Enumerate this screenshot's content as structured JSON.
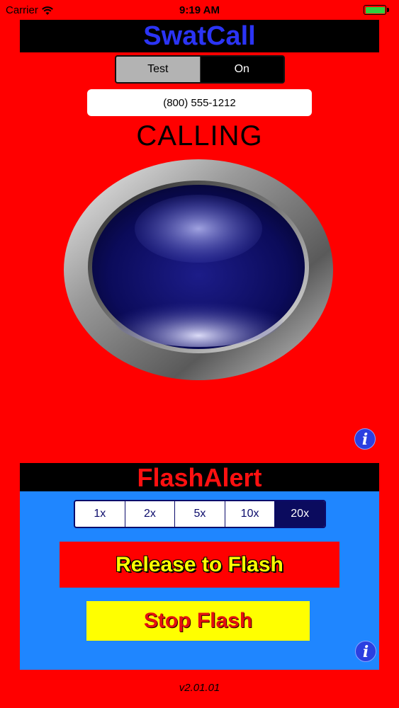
{
  "status_bar": {
    "carrier": "Carrier",
    "time": "9:19 AM",
    "battery_level": 1.0
  },
  "swatcall": {
    "title": "SwatCall",
    "title_color": "#2b34f5",
    "mode_options": [
      "Test",
      "On"
    ],
    "mode_selected": "Test",
    "phone_number": "(800) 555-1212",
    "status": "CALLING",
    "big_button_color": "#0a0a5a",
    "info_icon": "info-icon"
  },
  "flash_alert": {
    "title": "FlashAlert",
    "title_color": "#ff1010",
    "panel_color": "#1f86ff",
    "counts": [
      "1x",
      "2x",
      "5x",
      "10x",
      "20x"
    ],
    "count_selected": "20x",
    "release_label": "Release to Flash",
    "stop_label": "Stop Flash",
    "info_icon": "info-icon"
  },
  "footer": {
    "version": "v2.01.01"
  }
}
